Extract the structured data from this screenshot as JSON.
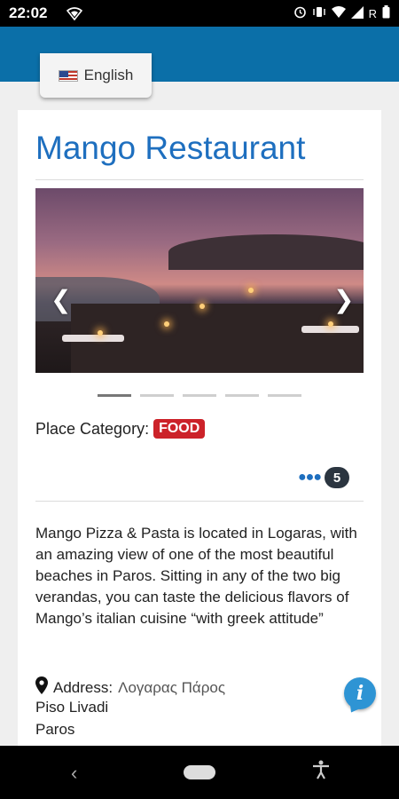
{
  "status_bar": {
    "time": "22:02",
    "left_icons": [
      "wifi-shield-icon"
    ],
    "right_icons": [
      "alarm-icon",
      "vibrate-icon",
      "wifi-icon",
      "signal-icon",
      "roaming-icon",
      "battery-icon"
    ],
    "roaming_label": "R"
  },
  "header": {
    "language_label": "English",
    "flag_icon": "us-flag-icon",
    "brand_color": "#0b6fa8"
  },
  "place": {
    "title": "Mango Restaurant",
    "carousel": {
      "slide_count": 5,
      "active_index": 0,
      "prev_icon": "chevron-left-icon",
      "next_icon": "chevron-right-icon"
    },
    "category_label": "Place Category:",
    "category_value": "FOOD",
    "category_color": "#cc2229",
    "comments_count": "5",
    "description": "Mango Pizza & Pasta is located in Logaras, with an amazing view of one of the most beautiful beaches in Paros. Sitting in any of the two big verandas, you can taste the delicious flavors of Mango’s italian cuisine “with greek attitude”",
    "address_label": "Address:",
    "address_value": "Λογαρας Πάρος",
    "address_line2": "Piso Livadi",
    "address_line3": "Paros"
  },
  "nav_bar": {
    "back_icon": "back-icon",
    "home_icon": "home-pill-icon",
    "accessibility_icon": "accessibility-icon"
  }
}
